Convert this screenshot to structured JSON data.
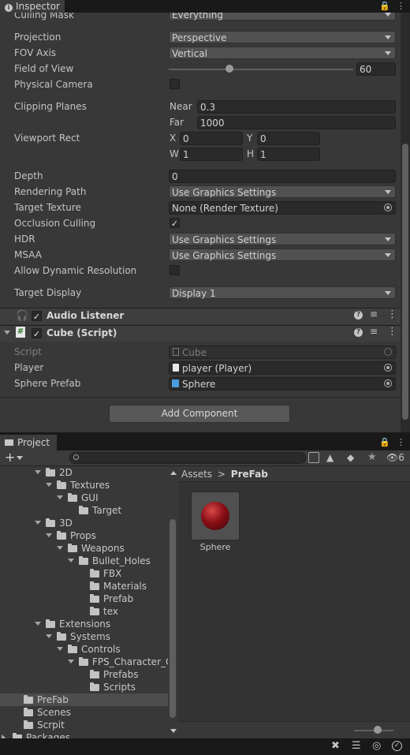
{
  "inspector": {
    "tab_label": "Inspector",
    "culling_mask": {
      "label": "Culling Mask",
      "value": "Everything"
    },
    "projection": {
      "label": "Projection",
      "value": "Perspective"
    },
    "fov_axis": {
      "label": "FOV Axis",
      "value": "Vertical"
    },
    "field_of_view": {
      "label": "Field of View",
      "value": "60",
      "slider_fraction": 0.33
    },
    "physical_camera": {
      "label": "Physical Camera",
      "checked": false
    },
    "clipping_planes": {
      "label": "Clipping Planes",
      "near_label": "Near",
      "near_value": "0.3",
      "far_label": "Far",
      "far_value": "1000"
    },
    "viewport_rect": {
      "label": "Viewport Rect",
      "x_label": "X",
      "x_value": "0",
      "y_label": "Y",
      "y_value": "0",
      "w_label": "W",
      "w_value": "1",
      "h_label": "H",
      "h_value": "1"
    },
    "depth": {
      "label": "Depth",
      "value": "0"
    },
    "rendering_path": {
      "label": "Rendering Path",
      "value": "Use Graphics Settings"
    },
    "target_texture": {
      "label": "Target Texture",
      "value": "None (Render Texture)"
    },
    "occlusion_culling": {
      "label": "Occlusion Culling",
      "checked": true
    },
    "hdr": {
      "label": "HDR",
      "value": "Use Graphics Settings"
    },
    "msaa": {
      "label": "MSAA",
      "value": "Use Graphics Settings"
    },
    "allow_dynamic_resolution": {
      "label": "Allow Dynamic Resolution",
      "checked": false
    },
    "target_display": {
      "label": "Target Display",
      "value": "Display 1"
    },
    "audio_listener": {
      "title": "Audio Listener",
      "enabled": true
    },
    "cube_script": {
      "title": "Cube (Script)",
      "enabled": true,
      "script": {
        "label": "Script",
        "value": "Cube"
      },
      "player": {
        "label": "Player",
        "value": "player (Player)"
      },
      "sphere_prefab": {
        "label": "Sphere Prefab",
        "value": "Sphere"
      }
    },
    "add_component_label": "Add Component"
  },
  "project": {
    "tab_label": "Project",
    "search_placeholder": "",
    "hidden_count": "6",
    "breadcrumb": {
      "root": "Assets",
      "separator": ">",
      "current": "PreFab"
    },
    "tree": [
      {
        "label": "2D"
      },
      {
        "label": "Textures"
      },
      {
        "label": "GUI"
      },
      {
        "label": "Target"
      },
      {
        "label": "3D"
      },
      {
        "label": "Props"
      },
      {
        "label": "Weapons"
      },
      {
        "label": "Bullet_Holes"
      },
      {
        "label": "FBX"
      },
      {
        "label": "Materials"
      },
      {
        "label": "Prefab"
      },
      {
        "label": "tex"
      },
      {
        "label": "Extensions"
      },
      {
        "label": "Systems"
      },
      {
        "label": "Controls"
      },
      {
        "label": "FPS_Character_C"
      },
      {
        "label": "Prefabs"
      },
      {
        "label": "Scripts"
      },
      {
        "label": "PreFab"
      },
      {
        "label": "Scenes"
      },
      {
        "label": "Scrpit"
      },
      {
        "label": "Packages"
      }
    ],
    "assets": [
      {
        "name": "Sphere"
      }
    ],
    "zoom_fraction": 0.6
  },
  "colors": {
    "panel_bg": "#383838",
    "selection": "#4d4d4d",
    "sphere": "#8b0f16"
  }
}
